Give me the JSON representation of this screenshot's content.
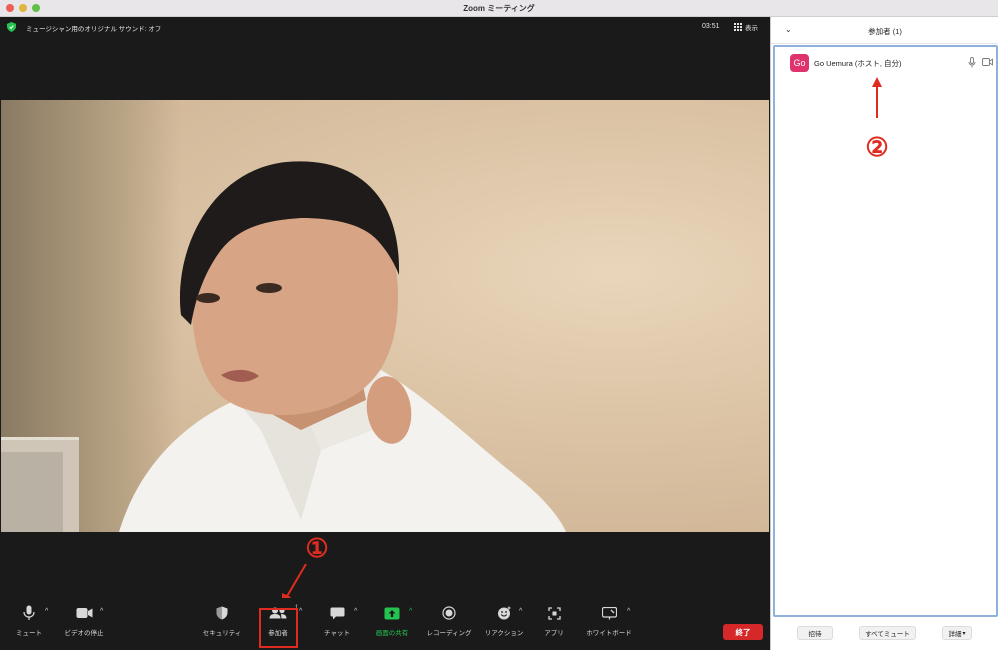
{
  "window": {
    "title": "Zoom ミーティング"
  },
  "meeting": {
    "info_text": "ミュージシャン用のオリジナル サウンド: オフ",
    "clock": "03:51",
    "view_label": "表示"
  },
  "toolbar": {
    "mute_label": "ミュート",
    "video_label": "ビデオの停止",
    "security_label": "セキュリティ",
    "participants_label": "参加者",
    "participants_count": "1",
    "chat_label": "チャット",
    "share_label": "画面の共有",
    "record_label": "レコーディング",
    "reactions_label": "リアクション",
    "apps_label": "アプリ",
    "whiteboard_label": "ホワイトボード",
    "end_label": "終了",
    "caret": "^"
  },
  "annotations": {
    "one": "①",
    "two": "②"
  },
  "panel": {
    "title": "参加者 (1)",
    "collapse": "⌄",
    "participants": [
      {
        "initials": "Go",
        "name": "Go Uemura (ホスト, 自分)"
      }
    ],
    "invite_label": "招待",
    "mute_all_label": "すべてミュート",
    "more_label": "詳細"
  },
  "colors": {
    "accent_red": "#e02b20",
    "avatar": "#e0336e",
    "share_green": "#25c451",
    "end_red": "#d62828"
  }
}
